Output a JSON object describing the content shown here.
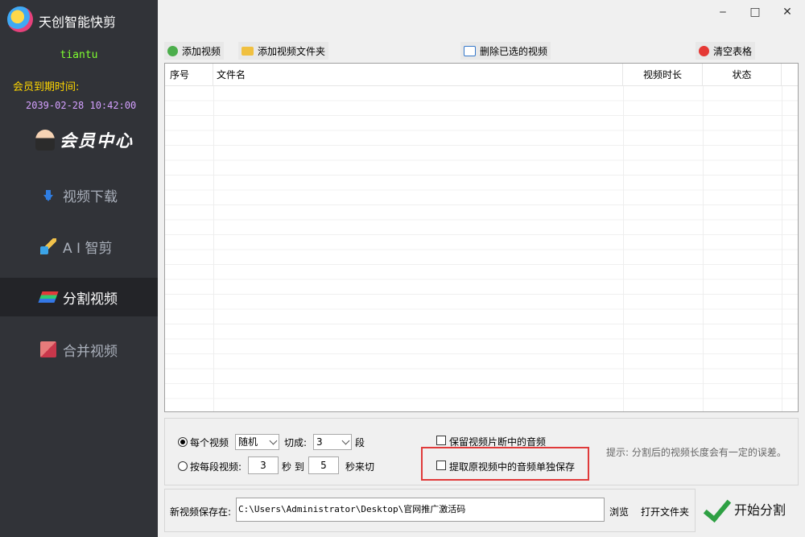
{
  "sidebar": {
    "app_title": "天创智能快剪",
    "username": "tiantu",
    "expire_label": "会员到期时间:",
    "expire_value": "2039-02-28 10:42:00",
    "member_center": "会员中心",
    "nav": [
      {
        "label": "视频下载",
        "icon": "download-icon"
      },
      {
        "label": "A I 智剪",
        "icon": "magic-wand-icon"
      },
      {
        "label": "分割视频",
        "icon": "split-icon",
        "active": true
      },
      {
        "label": "合并视频",
        "icon": "merge-icon"
      }
    ]
  },
  "window": {
    "minimize": "‒",
    "maximize": "□",
    "close": "✕"
  },
  "toolbar": {
    "add_video": "添加视频",
    "add_folder": "添加视频文件夹",
    "delete_selected": "删除已选的视频",
    "clear_table": "清空表格"
  },
  "table": {
    "columns": [
      "序号",
      "文件名",
      "视频时长",
      "状态"
    ],
    "rows": []
  },
  "options": {
    "per_video_label": "每个视频",
    "mode_value": "随机",
    "cut_label": "切成:",
    "segments_value": "3",
    "segments_unit": "段",
    "per_segment_label": "按每段视频:",
    "from_value": "3",
    "sec_to": "秒 到",
    "to_value": "5",
    "sec_cut": "秒来切",
    "keep_audio": "保留视频片断中的音频",
    "extract_audio": "提取原视频中的音频单独保存",
    "hint": "提示: 分割后的视频长度会有一定的误差。"
  },
  "save": {
    "label": "新视频保存在:",
    "path": "C:\\Users\\Administrator\\Desktop\\官网推广激活码",
    "browse": "浏览",
    "open_folder": "打开文件夹",
    "start": "开始分割"
  },
  "colors": {
    "sidebar_bg": "#313338",
    "sidebar_active": "#232428",
    "username": "#7fff30",
    "expire_label": "#ffd700",
    "expire_value": "#d4a0ff",
    "highlight": "#e03a3a",
    "start_check": "#2ea043"
  }
}
